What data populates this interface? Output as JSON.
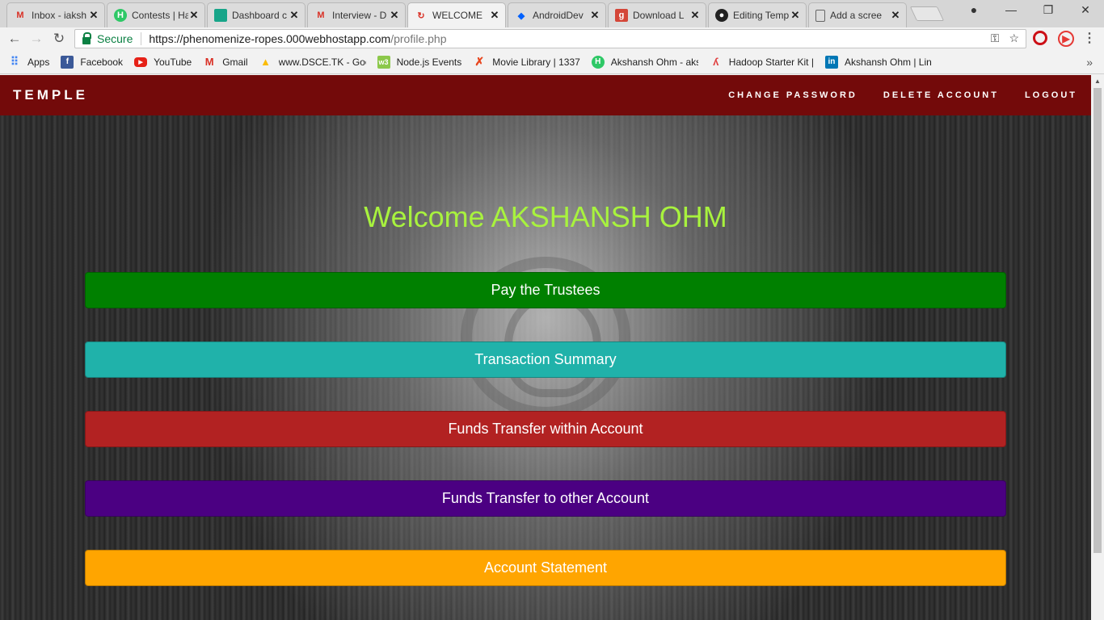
{
  "browser": {
    "tabs": [
      {
        "title": "Inbox - iaksh",
        "icon": "gmail-icon"
      },
      {
        "title": "Contests | Ha",
        "icon": "hackerearth-icon"
      },
      {
        "title": "Dashboard c",
        "icon": "dashboard-icon"
      },
      {
        "title": "Interview - D",
        "icon": "gmail-icon"
      },
      {
        "title": "WELCOME",
        "icon": "page-icon"
      },
      {
        "title": "AndroidDev",
        "icon": "dropbox-icon"
      },
      {
        "title": "Download L",
        "icon": "g-icon"
      },
      {
        "title": "Editing Temp",
        "icon": "github-icon"
      },
      {
        "title": "Add a scree",
        "icon": "document-icon"
      }
    ],
    "active_tab": 4,
    "secure_label": "Secure",
    "url_host": "https://phenomenize-ropes.000webhostapp.com",
    "url_path": "/profile.php",
    "bookmarks": [
      {
        "label": "Apps"
      },
      {
        "label": "Facebook"
      },
      {
        "label": "YouTube"
      },
      {
        "label": "Gmail"
      },
      {
        "label": "www.DSCE.TK - Goo"
      },
      {
        "label": "Node.js Events"
      },
      {
        "label": "Movie Library | 1337"
      },
      {
        "label": "Akshansh Ohm - aks"
      },
      {
        "label": "Hadoop Starter Kit |"
      },
      {
        "label": "Akshansh Ohm | Link"
      }
    ]
  },
  "site": {
    "brand": "TEMPLE",
    "nav": {
      "change_password": "CHANGE PASSWORD",
      "delete_account": "DELETE ACCOUNT",
      "logout": "LOGOUT"
    },
    "welcome": "Welcome AKSHANSH OHM",
    "actions": [
      {
        "label": "Pay the Trustees",
        "color": "#008000"
      },
      {
        "label": "Transaction Summary",
        "color": "#20b2aa"
      },
      {
        "label": "Funds Transfer within Account",
        "color": "#b22222"
      },
      {
        "label": "Funds Transfer to other Account",
        "color": "#4b0082"
      },
      {
        "label": "Account Statement",
        "color": "#ffa500"
      }
    ]
  }
}
